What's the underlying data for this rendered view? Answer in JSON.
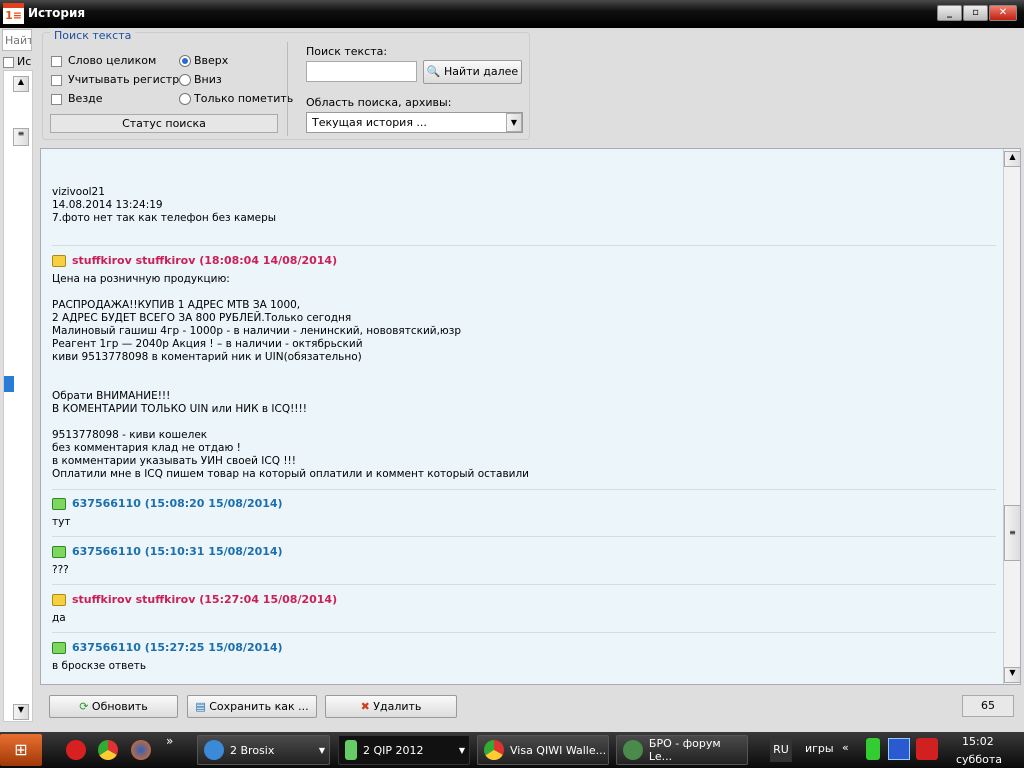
{
  "window": {
    "title": "История",
    "controls": [
      "_",
      "▫",
      "✕"
    ]
  },
  "left_panel": {
    "search_placeholder": "Найт",
    "checkbox_label": "Ис"
  },
  "search_group": {
    "legend": "Поиск текста",
    "checkboxes": [
      {
        "label": "Слово целиком",
        "checked": false
      },
      {
        "label": "Учитывать регистр",
        "checked": false
      },
      {
        "label": "Везде",
        "checked": false
      }
    ],
    "radios": [
      {
        "label": "Вверх",
        "selected": true
      },
      {
        "label": "Вниз",
        "selected": false
      },
      {
        "label": "Только пометить",
        "selected": false
      }
    ],
    "status_label": "Статус поиска",
    "search_text_label": "Поиск текста:",
    "search_value": "",
    "find_next": "Найти далее",
    "scope_label": "Область поиска, архивы:",
    "scope_value": "Текущая история ..."
  },
  "colors": {
    "outgoing": "#cc1f55",
    "incoming": "#1b6fae",
    "chat_bg": "#ebf5fa"
  },
  "messages": [
    {
      "header": "",
      "text": "vizivool21\n14.08.2014 13:24:19\n7.фото нет так как телефон без камеры"
    },
    {
      "header": "stuffkirov stuffkirov (18:08:04 14/08/2014)",
      "dir": "out",
      "text": "Цена на розничную продукцию:\n\nРАСПРОДАЖА!!КУПИВ 1 АДРЕС МТВ ЗА 1000,\n2 АДРЕС БУДЕТ ВСЕГО ЗА 800 РУБЛЕЙ.Только сегодня\nМалиновый гашиш 4гр - 1000р - в наличии - ленинский, нововятский,юзр\nРеагент 1гр — 2040р Акция ! – в наличии - октябрьский\nкиви 9513778098 в коментарий ник и UIN(обязательно)\n\n\nОбрати ВНИМАНИЕ!!!\nВ КОМЕНТАРИИ ТОЛЬКО UIN или НИК в ICQ!!!!\n\n9513778098 - киви кошелек\nбез комментария клад не отдаю !\nв комментарии указывать УИН своей ICQ !!!\nОплатили мне в ICQ пишем товар на который оплатили и коммент который оставили"
    },
    {
      "header": "637566110 (15:08:20 15/08/2014)",
      "dir": "in",
      "text": "тут"
    },
    {
      "header": "637566110 (15:10:31 15/08/2014)",
      "dir": "in",
      "text": "???"
    },
    {
      "header": "stuffkirov stuffkirov (15:27:04 15/08/2014)",
      "dir": "out",
      "text": "да"
    },
    {
      "header": "637566110 (15:27:25 15/08/2014)",
      "dir": "in",
      "text": "в броскзе ответь"
    }
  ],
  "bottom": {
    "refresh": "Обновить",
    "save_as": "Сохранить как ...",
    "delete": "Удалить",
    "count": "65"
  },
  "taskbar": {
    "tasks": [
      {
        "label": "2 Brosix"
      },
      {
        "label": "2 QIP 2012",
        "active": true
      },
      {
        "label": "Visa QIWI Walle..."
      },
      {
        "label": "БРО - форум Le..."
      }
    ],
    "lang": "RU",
    "toolbar": "игры",
    "chevron": "«",
    "quicklaunch_more": "»",
    "time": "15:02",
    "day": "суббота"
  }
}
